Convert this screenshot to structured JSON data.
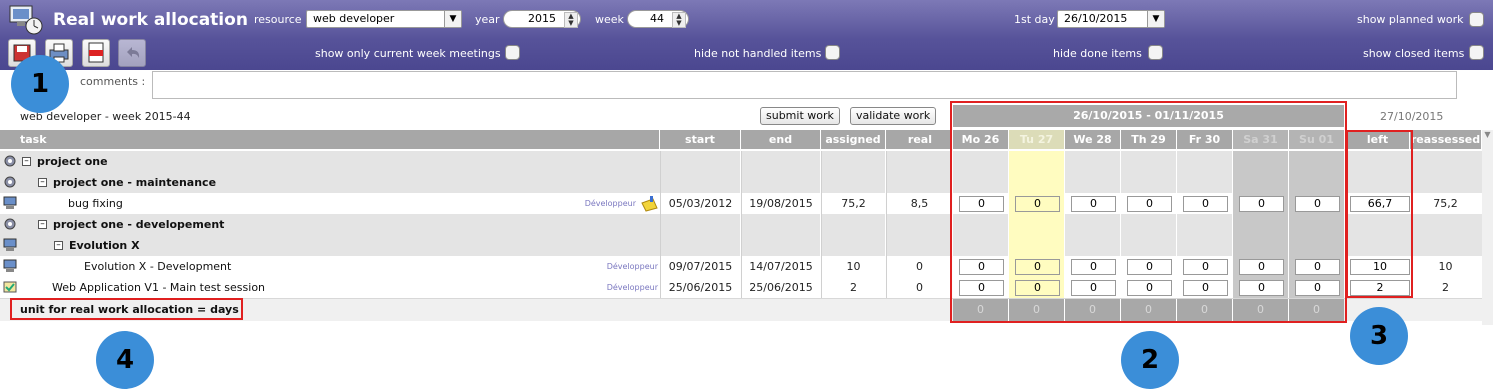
{
  "header": {
    "title": "Real work allocation",
    "resource_label": "resource",
    "resource_value": "web developer",
    "year_label": "year",
    "year_value": "2015",
    "week_label": "week",
    "week_value": "44",
    "first_day_label": "1st day",
    "first_day_value": "26/10/2015",
    "show_planned_work": "show planned work",
    "show_current_week_meetings": "show only current week meetings",
    "hide_not_handled": "hide not handled items",
    "hide_done": "hide done items",
    "show_closed": "show closed items"
  },
  "toolbar": {
    "icons": [
      "save-icon",
      "print-icon",
      "pdf-icon",
      "undo-icon"
    ]
  },
  "comments": {
    "label": "comments :",
    "value": ""
  },
  "sheet": {
    "subtitle": "web developer - week 2015-44",
    "submit_label": "submit work",
    "validate_label": "validate work",
    "week_range": "26/10/2015 - 01/11/2015",
    "today": "27/10/2015"
  },
  "columns": {
    "task": "task",
    "start": "start",
    "end": "end",
    "assigned": "assigned",
    "real": "real",
    "days": [
      "Mo 26",
      "Tu 27",
      "We 28",
      "Th 29",
      "Fr 30",
      "Sa 31",
      "Su 01"
    ],
    "left": "left",
    "reassessed": "reassessed"
  },
  "rows": [
    {
      "type": "project",
      "level": 0,
      "name": "project one",
      "icon": "gear-icon"
    },
    {
      "type": "project",
      "level": 1,
      "name": "project one - maintenance",
      "icon": "gear-icon"
    },
    {
      "type": "task",
      "name": "bug fixing",
      "resource": "Développeur",
      "start": "05/03/2012",
      "end": "19/08/2015",
      "assigned": "75,2",
      "real": "8,5",
      "days": [
        "0",
        "0",
        "0",
        "0",
        "0",
        "0",
        "0"
      ],
      "left": "66,7",
      "reassessed": "75,2",
      "icon": "computer-icon",
      "note_icon": "note-icon"
    },
    {
      "type": "project",
      "level": 1,
      "name": "project one - developement",
      "icon": "gear-icon"
    },
    {
      "type": "activity",
      "level": 2,
      "name": "Evolution X",
      "icon": "computer-icon"
    },
    {
      "type": "task",
      "name": "Evolution X - Development",
      "resource": "Développeur",
      "start": "09/07/2015",
      "end": "14/07/2015",
      "assigned": "10",
      "real": "0",
      "days": [
        "0",
        "0",
        "0",
        "0",
        "0",
        "0",
        "0"
      ],
      "left": "10",
      "reassessed": "10",
      "icon": "computer-icon"
    },
    {
      "type": "task",
      "name": "Web Application V1 - Main test session",
      "resource": "Développeur",
      "start": "25/06/2015",
      "end": "25/06/2015",
      "assigned": "2",
      "real": "0",
      "days": [
        "0",
        "0",
        "0",
        "0",
        "0",
        "0",
        "0"
      ],
      "left": "2",
      "reassessed": "2",
      "icon": "test-icon"
    }
  ],
  "footer": {
    "unit_text": "unit for real work allocation = days",
    "totals": [
      "0",
      "0",
      "0",
      "0",
      "0",
      "0",
      "0"
    ]
  },
  "callouts": [
    "1",
    "2",
    "3",
    "4"
  ],
  "colors": {
    "header_bar": "#5a569c",
    "table_header": "#a7a7a7",
    "today_column": "#ffffc8",
    "weekend_column": "#c8c8c8",
    "highlight": "#e02020",
    "callout": "#3b8ed8"
  }
}
